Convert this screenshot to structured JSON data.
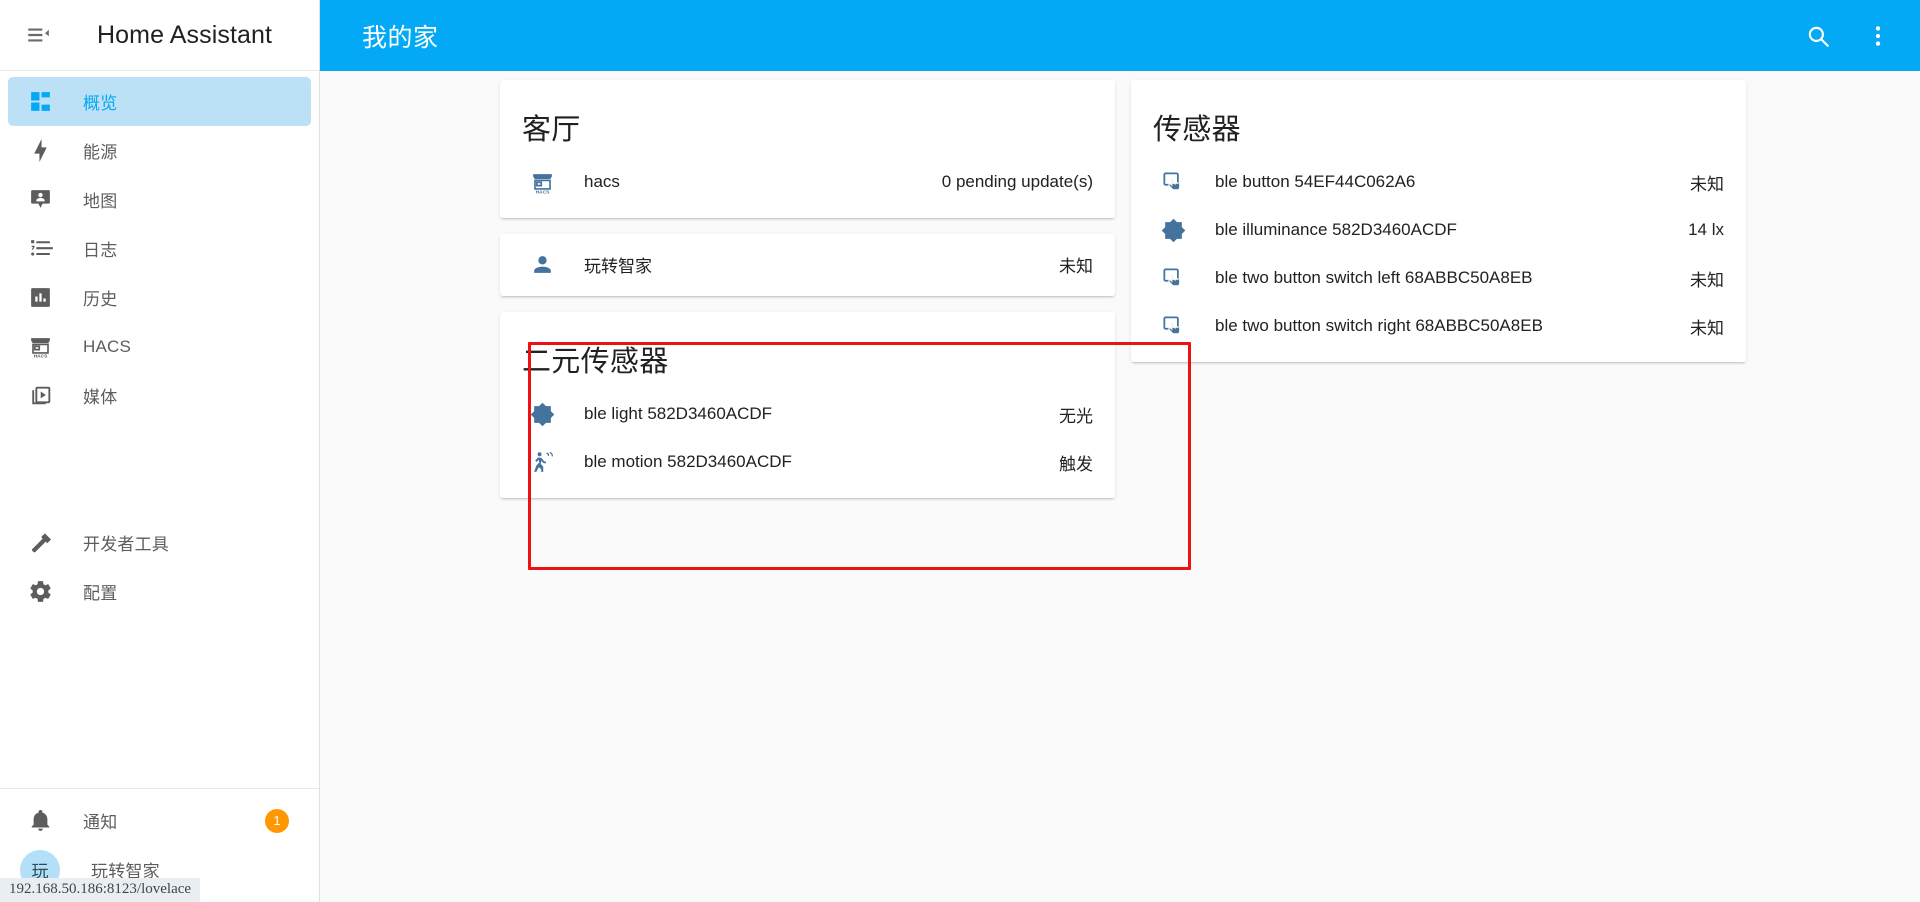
{
  "sidebar": {
    "title": "Home Assistant",
    "menu_icon": "menu-open-icon",
    "items": [
      {
        "label": "概览",
        "icon": "view-dashboard-icon",
        "active": true
      },
      {
        "label": "能源",
        "icon": "lightning-bolt-icon",
        "active": false
      },
      {
        "label": "地图",
        "icon": "map-marker-account-icon",
        "active": false
      },
      {
        "label": "日志",
        "icon": "format-list-bulleted-icon",
        "active": false
      },
      {
        "label": "历史",
        "icon": "chart-box-icon",
        "active": false
      },
      {
        "label": "HACS",
        "icon": "hacs-storefront-icon",
        "active": false
      },
      {
        "label": "媒体",
        "icon": "play-box-multiple-icon",
        "active": false
      }
    ],
    "tools": [
      {
        "label": "开发者工具",
        "icon": "hammer-wrench-icon"
      },
      {
        "label": "配置",
        "icon": "cog-icon"
      }
    ],
    "bottom": [
      {
        "label": "通知",
        "icon": "bell-icon",
        "badge": "1"
      },
      {
        "label": "玩转智家",
        "icon": "user-avatar",
        "avatar_initial": "玩"
      }
    ]
  },
  "status_url": "192.168.50.186:8123/lovelace",
  "header": {
    "title": "我的家",
    "search_icon": "search-icon",
    "overflow_icon": "dots-vertical-icon"
  },
  "colors": {
    "accent": "#03a9f4",
    "active_nav_bg": "#bce0f5",
    "badge": "#ff9800",
    "entity_icon": "#44739e",
    "highlight": "#ee1111"
  },
  "cards": {
    "left": [
      {
        "title": "客厅",
        "entities": [
          {
            "icon": "hacs-storefront-icon",
            "name": "hacs",
            "state": "0 pending update(s)"
          }
        ]
      },
      {
        "title": "",
        "entities": [
          {
            "icon": "account-icon",
            "name": "玩转智家",
            "state": "未知"
          }
        ]
      },
      {
        "title": "二元传感器",
        "highlighted": true,
        "entities": [
          {
            "icon": "brightness-icon",
            "name": "ble light 582D3460ACDF",
            "state": "无光"
          },
          {
            "icon": "motion-sensor-icon",
            "name": "ble motion 582D3460ACDF",
            "state": "触发"
          }
        ]
      }
    ],
    "right": [
      {
        "title": "传感器",
        "entities": [
          {
            "icon": "gesture-tap-button-icon",
            "name": "ble button 54EF44C062A6",
            "state": "未知"
          },
          {
            "icon": "brightness-icon",
            "name": "ble illuminance 582D3460ACDF",
            "state": "14 lx"
          },
          {
            "icon": "gesture-tap-button-icon",
            "name": "ble two button switch left 68ABBC50A8EB",
            "state": "未知"
          },
          {
            "icon": "gesture-tap-button-icon",
            "name": "ble two button switch right 68ABBC50A8EB",
            "state": "未知"
          }
        ]
      }
    ]
  }
}
